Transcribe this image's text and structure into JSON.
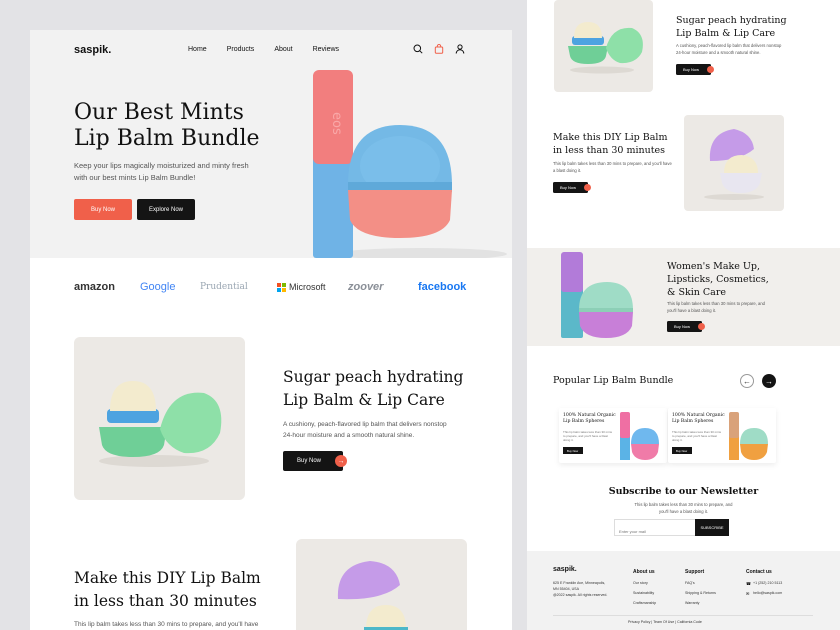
{
  "left": {
    "logo": "saspik.",
    "nav": [
      "Home",
      "Products",
      "About",
      "Reviews"
    ],
    "hero": {
      "title_line1": "Our Best Mints",
      "title_line2": "Lip Balm Bundle",
      "desc_line1": "Keep your lips magically moisturized and minty fresh",
      "desc_line2": "with our best mints Lip Balm Bundle!",
      "buy_label": "Buy Now",
      "explore_label": "Explore Now",
      "product_text": "eos"
    },
    "brands": [
      "amazon",
      "Google",
      "Prudential",
      "Microsoft",
      "zoover",
      "facebook"
    ],
    "feature": {
      "title_line1": "Sugar peach hydrating",
      "title_line2": "Lip Balm & Lip Care",
      "desc_line1": "A cushiony, peach-flavored lip balm that delivers nonstop",
      "desc_line2": "24-hour moisture and a smooth natural shine.",
      "buy_label": "Buy Now"
    },
    "diy": {
      "title_line1": "Make this DIY Lip Balm",
      "title_line2": "in less than 30 minutes",
      "desc": "This lip balm takes less than 30 mins to prepare, and you'll have"
    }
  },
  "right": {
    "sugar": {
      "title_line1": "Sugar peach hydrating",
      "title_line2": "Lip Balm & Lip Care",
      "desc_line1": "A cushiony, peach-flavored lip balm that delivers nonstop",
      "desc_line2": "24-hour moisture and a smooth natural shine.",
      "buy_label": "Buy Now"
    },
    "diy": {
      "title_line1": "Make this DIY Lip Balm",
      "title_line2": "in less than 30 minutes",
      "desc_line1": "This lip balm takes less than 30 mins to prepare, and you'll have",
      "desc_line2": "a blast doing it.",
      "buy_label": "Buy Now"
    },
    "women": {
      "title_line1": "Women's Make Up,",
      "title_line2": "Lipsticks, Cosmetics,",
      "title_line3": "& Skin Care",
      "desc_line1": "This lip balm takes less than 30 mins to prepare, and",
      "desc_line2": "you'll have a blast doing it.",
      "buy_label": "Buy Now"
    },
    "popular": {
      "title": "Popular Lip Balm Bundle",
      "prev": "←",
      "next": "→",
      "cards": [
        {
          "title_line1": "100% Natural Organic",
          "title_line2": "Lip Balm Spheres",
          "desc": "This lip balm takes less than 30 mins to prepare, and you'll have a blast doing it.",
          "buy_label": "Buy Now"
        },
        {
          "title_line1": "100% Natural Organic",
          "title_line2": "Lip Balm Spheres",
          "desc": "This lip balm takes less than 30 mins to prepare, and you'll have a blast doing it.",
          "buy_label": "Buy Now"
        }
      ]
    },
    "newsletter": {
      "title": "Subscribe to our Newsletter",
      "desc_line1": "This lip balm takes less than 30 mins to prepare, and",
      "desc_line2": "you'll have a blast doing it.",
      "placeholder": "Enter your mail",
      "button": "SUBSCRIBE"
    },
    "footer": {
      "logo": "saspik.",
      "address_line1": "625 E Franklin Ave, Minneapolis,",
      "address_line2": "MN 55404, USA",
      "copyright": "@2022 saspik. All rights reserved.",
      "about_head": "About us",
      "about_links": [
        "Our story",
        "Sustainability",
        "Craftsmanship"
      ],
      "support_head": "Support",
      "support_links": [
        "FAQ's",
        "Shipping & Returns",
        "Warranty"
      ],
      "contact_head": "Contact us",
      "phone": "+1 (252) 210 5113",
      "email": "hello@saspik.com",
      "legal": "Privacy Policy  |  Team Of Use  |  California Code"
    }
  }
}
